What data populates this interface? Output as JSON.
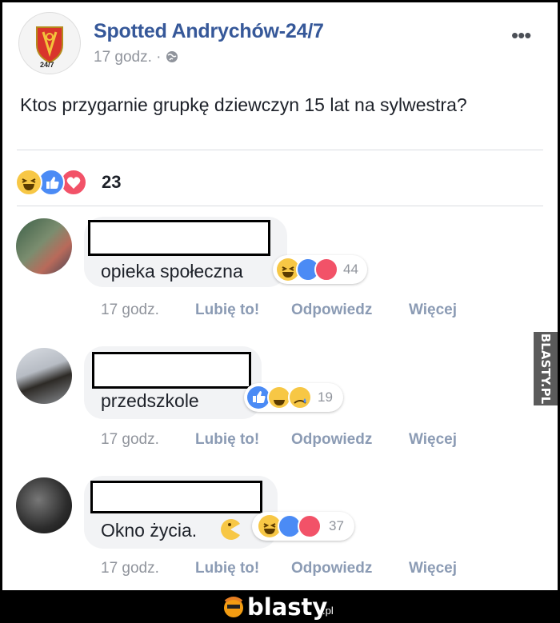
{
  "post": {
    "page_name": "Spotted Andrychów-24/7",
    "time": "17 godz. · ",
    "globe_icon": "globe-icon",
    "avatar_label": "24/7",
    "text": "Ktos przygarnie grupkę dziewczyn 15 lat na sylwestra?",
    "reaction_count": "23",
    "reactions": [
      "haha",
      "like",
      "love"
    ]
  },
  "comments": [
    {
      "text": "opieka społeczna",
      "reaction_count": "44",
      "reactions": [
        "haha",
        "like",
        "love"
      ],
      "time": "17 godz.",
      "like": "Lubię to!",
      "reply": "Odpowiedz",
      "more": "Więcej"
    },
    {
      "text": "przedszkole",
      "reaction_count": "19",
      "reactions": [
        "like",
        "haha",
        "sad"
      ],
      "time": "17 godz.",
      "like": "Lubię to!",
      "reply": "Odpowiedz",
      "more": "Więcej"
    },
    {
      "text": "Okno życia.",
      "emoji": "pacman",
      "reaction_count": "37",
      "reactions": [
        "haha",
        "like",
        "love"
      ],
      "time": "17 godz.",
      "like": "Lubię to!",
      "reply": "Odpowiedz",
      "more": "Więcej"
    }
  ],
  "watermark": {
    "side": "BLASTY.PL",
    "logo": "blasty",
    "tld": ".pl"
  },
  "colors": {
    "link": "#365899",
    "meta": "#90949c",
    "like": "#4b8bf5",
    "love": "#f25268",
    "haha": "#f7c745"
  }
}
